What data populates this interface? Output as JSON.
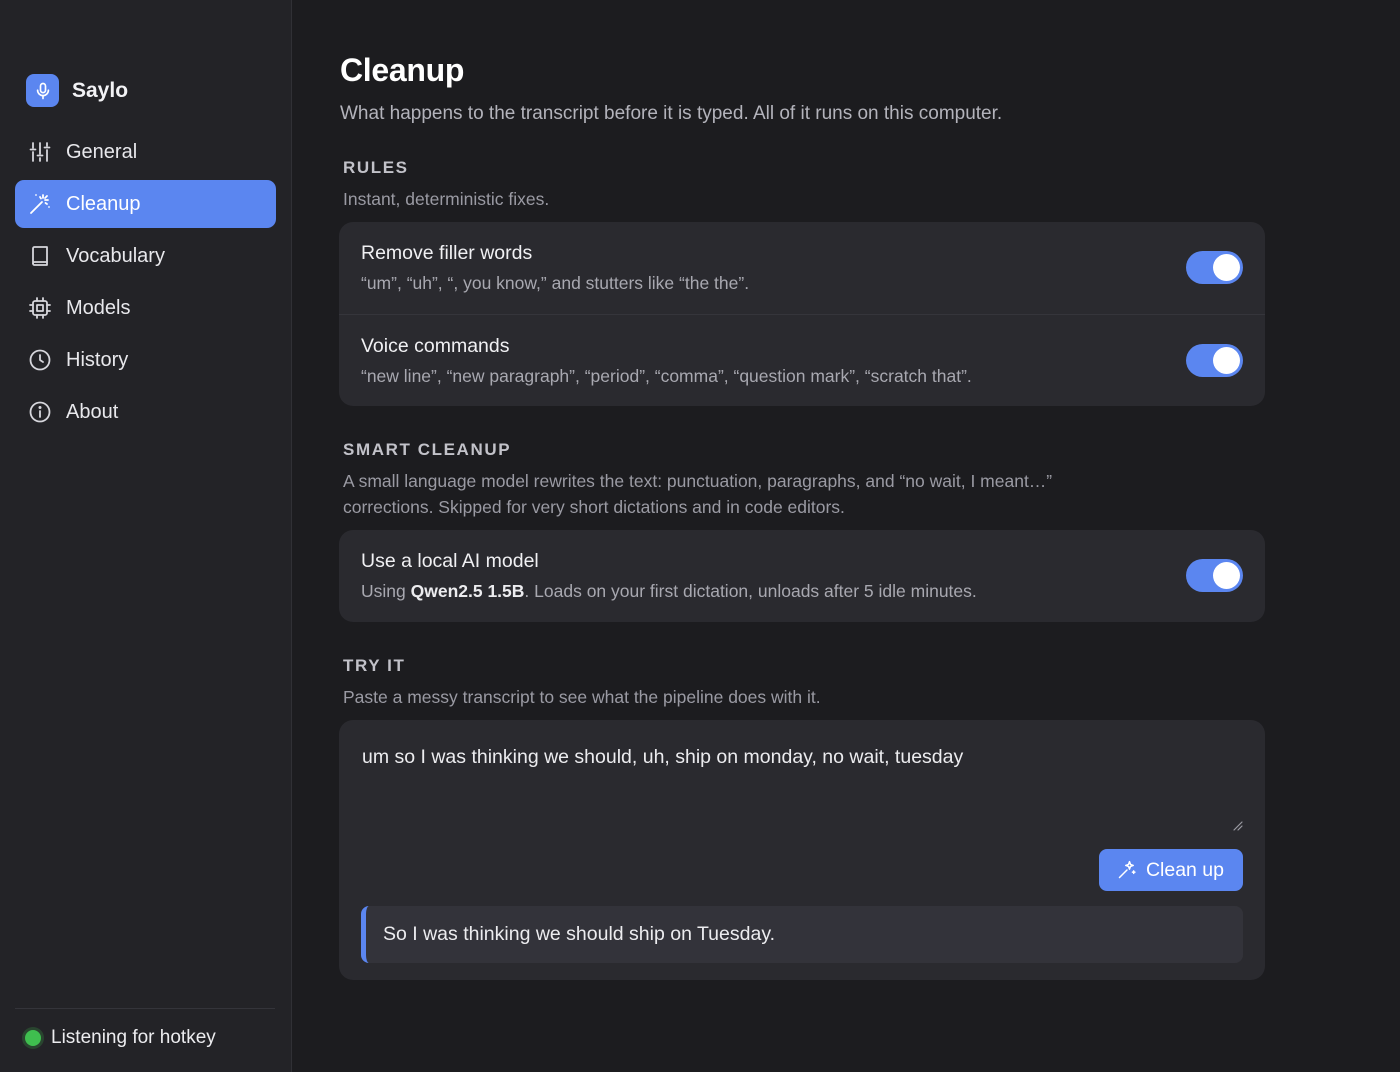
{
  "app": {
    "name": "Saylo"
  },
  "colors": {
    "accent": "#5b86f0",
    "status_ok": "#3fbe4f",
    "background": "#1c1c1f",
    "sidebar": "#232327",
    "card": "#2a2a2f"
  },
  "sidebar": {
    "items": [
      {
        "label": "General",
        "icon": "sliders-icon",
        "active": false
      },
      {
        "label": "Cleanup",
        "icon": "magic-wand-icon",
        "active": true
      },
      {
        "label": "Vocabulary",
        "icon": "book-icon",
        "active": false
      },
      {
        "label": "Models",
        "icon": "chip-icon",
        "active": false
      },
      {
        "label": "History",
        "icon": "clock-icon",
        "active": false
      },
      {
        "label": "About",
        "icon": "info-icon",
        "active": false
      }
    ],
    "status": "Listening for hotkey"
  },
  "page": {
    "title": "Cleanup",
    "subtitle": "What happens to the transcript before it is typed. All of it runs on this computer."
  },
  "rules": {
    "label": "RULES",
    "desc": "Instant, deterministic fixes.",
    "items": [
      {
        "title": "Remove filler words",
        "desc": "“um”, “uh”, “, you know,” and stutters like “the the”.",
        "enabled": true
      },
      {
        "title": "Voice commands",
        "desc": "“new line”, “new paragraph”, “period”, “comma”, “question mark”, “scratch that”.",
        "enabled": true
      }
    ]
  },
  "smart": {
    "label": "SMART CLEANUP",
    "desc_line1": "A small language model rewrites the text: punctuation, paragraphs, and “no wait, I meant…”",
    "desc_line2": "corrections. Skipped for very short dictations and in code editors.",
    "item": {
      "title": "Use a local AI model",
      "desc_prefix": "Using ",
      "model": "Qwen2.5 1.5B",
      "desc_suffix": ". Loads on your first dictation, unloads after 5 idle minutes.",
      "enabled": true
    }
  },
  "try": {
    "label": "TRY IT",
    "desc": "Paste a messy transcript to see what the pipeline does with it.",
    "input": "um so I was thinking we should, uh, ship on monday, no wait, tuesday",
    "button": "Clean up",
    "result": "So I was thinking we should ship on Tuesday."
  }
}
